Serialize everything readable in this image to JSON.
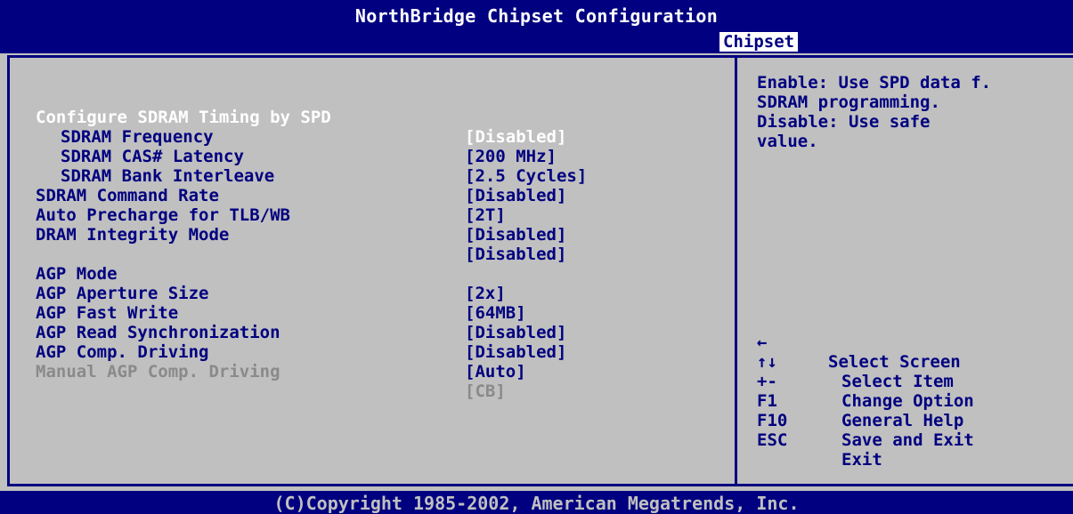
{
  "header": {
    "title": "NorthBridge Chipset Configuration",
    "tab": "Chipset"
  },
  "settings": {
    "configure_sdram_timing": {
      "label": "Configure SDRAM Timing by SPD",
      "value": "[Disabled]"
    },
    "sdram_frequency": {
      "label": "SDRAM Frequency",
      "value": "[200 MHz]"
    },
    "sdram_cas_latency": {
      "label": "SDRAM CAS# Latency",
      "value": "[2.5 Cycles]"
    },
    "sdram_bank_interleave": {
      "label": "SDRAM Bank Interleave",
      "value": "[Disabled]"
    },
    "sdram_command_rate": {
      "label": "SDRAM Command Rate",
      "value": "[2T]"
    },
    "auto_precharge": {
      "label": "Auto Precharge for TLB/WB",
      "value": "[Disabled]"
    },
    "dram_integrity_mode": {
      "label": "DRAM Integrity Mode",
      "value": "[Disabled]"
    },
    "agp_mode": {
      "label": "AGP Mode",
      "value": "[2x]"
    },
    "agp_aperture_size": {
      "label": "AGP Aperture Size",
      "value": "[64MB]"
    },
    "agp_fast_write": {
      "label": "AGP Fast Write",
      "value": "[Disabled]"
    },
    "agp_read_sync": {
      "label": "AGP Read Synchronization",
      "value": "[Disabled]"
    },
    "agp_comp_driving": {
      "label": "AGP Comp. Driving",
      "value": "[Auto]"
    },
    "manual_agp_comp_driving": {
      "label": "Manual AGP Comp. Driving",
      "value": "[CB]"
    }
  },
  "help": {
    "line1": "Enable: Use SPD data f.",
    "line2": "SDRAM programming.",
    "line3": "Disable: Use safe",
    "line4": "value."
  },
  "keys": {
    "select_screen": {
      "key": "←",
      "action": "Select Screen"
    },
    "select_item": {
      "key": "↑↓",
      "action": "Select Item"
    },
    "change_option": {
      "key": "+-",
      "action": "Change Option"
    },
    "general_help": {
      "key": "F1",
      "action": "General Help"
    },
    "save_exit": {
      "key": "F10",
      "action": "Save and Exit"
    },
    "exit": {
      "key": "ESC",
      "action": "Exit"
    }
  },
  "footer": {
    "copyright": "(C)Copyright 1985-2002, American Megatrends, Inc."
  },
  "colors": {
    "background": "#c0c0c0",
    "frame_blue": "#000080",
    "highlight_text": "#ffffff",
    "disabled_text": "#8a8a8a"
  }
}
